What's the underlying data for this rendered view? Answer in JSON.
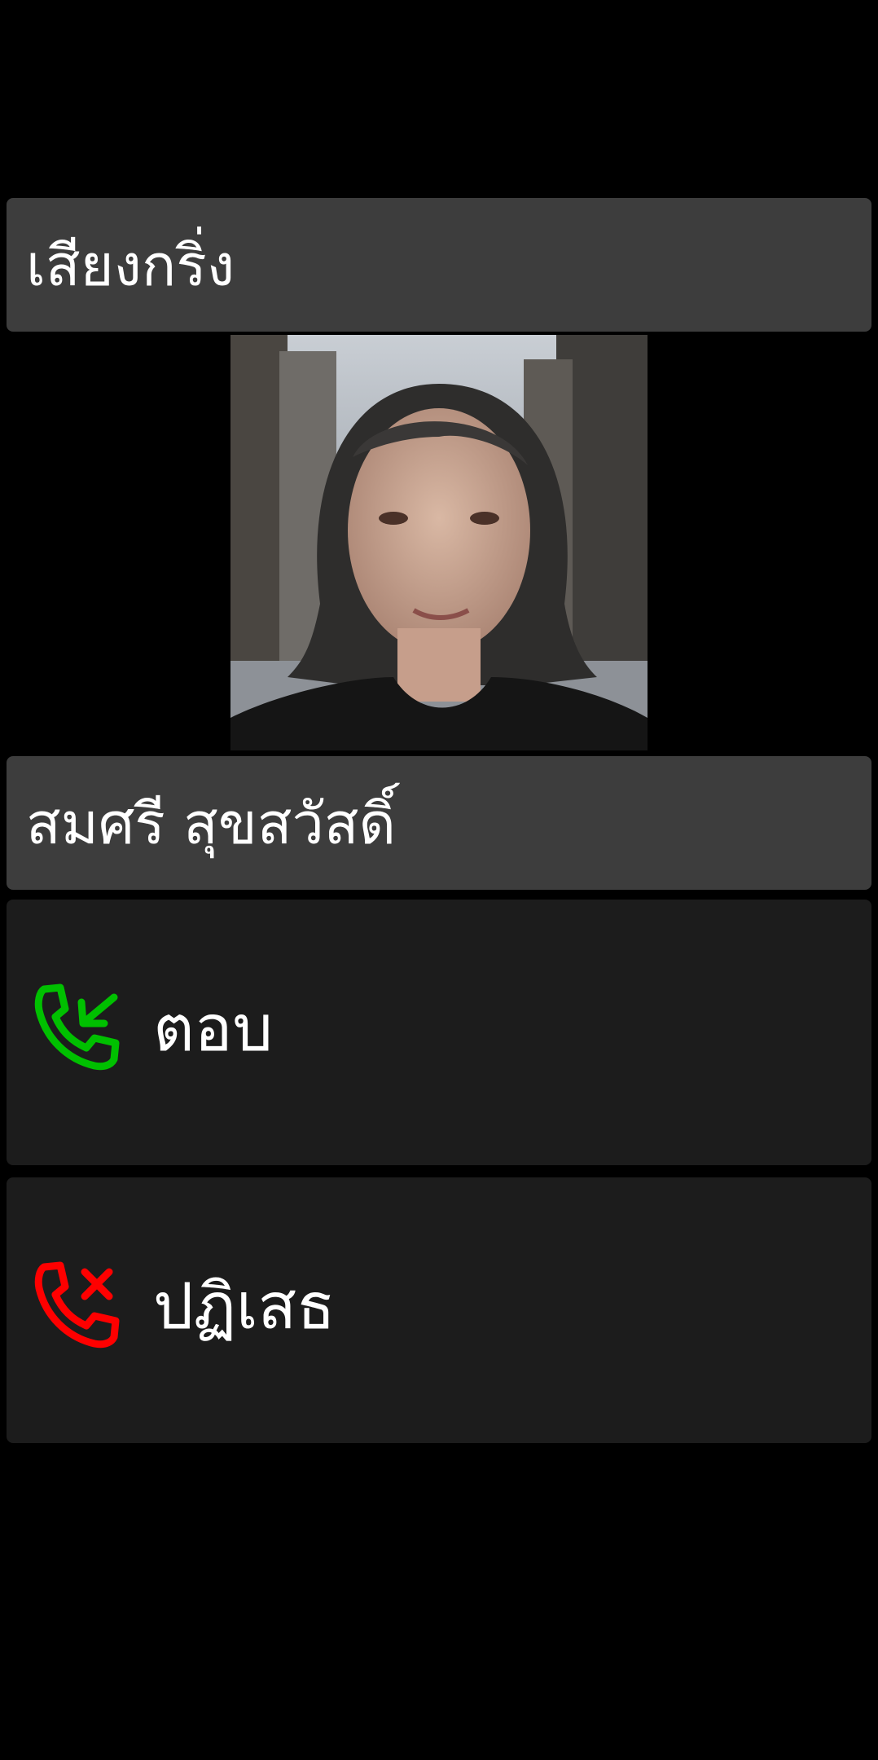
{
  "header": {
    "title": "เสียงกริ่ง"
  },
  "caller": {
    "name": "สมศรี สุขสวัสดิ์"
  },
  "actions": {
    "answer": {
      "label": "ตอบ",
      "icon": "phone-incoming-icon",
      "color": "#00c000"
    },
    "decline": {
      "label": "ปฏิเสธ",
      "icon": "phone-decline-icon",
      "color": "#ff0000"
    }
  }
}
